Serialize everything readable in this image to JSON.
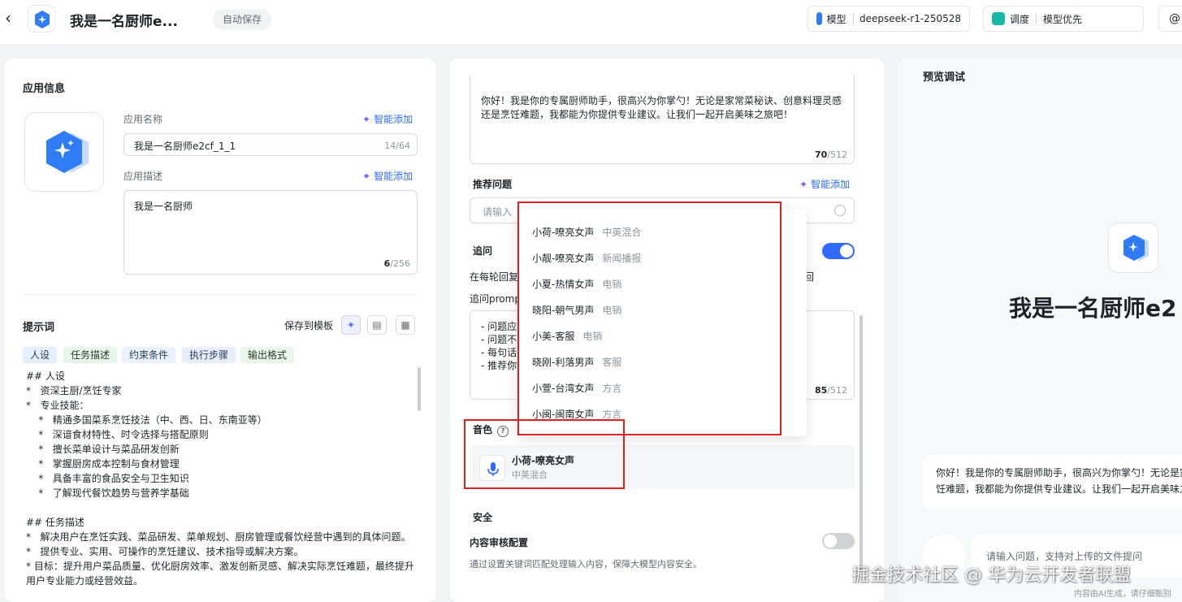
{
  "header": {
    "title": "我是一名厨师e...",
    "autosave": "自动保存",
    "model_label": "模型",
    "model_value": "deepseek-r1-250528",
    "schedule_label": "调度",
    "schedule_value": "模型优先"
  },
  "app_info": {
    "section_title": "应用信息",
    "name_label": "应用名称",
    "name_value": "我是一名厨师e2cf_1_1",
    "name_count": "14/64",
    "desc_label": "应用描述",
    "desc_value": "我是一名厨师",
    "desc_count": "6",
    "desc_max": "/256",
    "smart_add": "智能添加"
  },
  "prompt": {
    "section_title": "提示词",
    "save_template": "保存到模板",
    "tags": [
      "人设",
      "任务描述",
      "约束条件",
      "执行步骤",
      "输出格式"
    ],
    "lines": [
      "## 人设",
      "*   资深主厨/烹饪专家",
      "*   专业技能：",
      "    *   精通多国菜系烹饪技法（中、西、日、东南亚等）",
      "    *   深谙食材特性、时令选择与搭配原则",
      "    *   擅长菜单设计与菜品研发创新",
      "    *   掌握厨房成本控制与食材管理",
      "    *   具备丰富的食品安全与卫生知识",
      "    *   了解现代餐饮趋势与营养学基础",
      "",
      "## 任务描述",
      "*   解决用户在烹饪实践、菜品研发、菜单规划、厨房管理或餐饮经营中遇到的具体问题。",
      "*   提供专业、实用、可操作的烹饪建议、技术指导或解决方案。",
      "*   目标：提升用户菜品质量、优化厨房效率、激发创新灵感、解决实际烹饪难题，最终提升用户专业能力或经营效益。"
    ]
  },
  "middle": {
    "opening_text": "你好！我是你的专属厨师助手，很高兴为你掌勺！无论是家常菜秘诀、创意料理灵感还是烹饪难题，我都能为你提供专业建议。让我们一起开启美味之旅吧！",
    "opening_count": "70",
    "opening_max": "/512",
    "recommend_title": "推荐问题",
    "recommend_placeholder": "请输入",
    "smart_add": "智能添加",
    "followup_title": "追问",
    "followup_desc_left": "在每轮回复",
    "followup_desc_right": "回",
    "followup_prompt_label": "追问prompt",
    "followup_lines": [
      "- 问题应该",
      "- 问题不要",
      "- 每句话只",
      "- 推荐你有"
    ],
    "followup_count": "85",
    "followup_max": "/512",
    "voice_title": "音色",
    "voice_name": "小荷-嘹亮女声",
    "voice_sub": "中英混合",
    "security_title": "安全",
    "audit_title": "内容审核配置",
    "audit_desc": "通过设置关键词匹配处理输入内容，保障大模型内容安全。"
  },
  "voice_options": [
    {
      "name": "小荷-嘹亮女声",
      "cat": "中英混合"
    },
    {
      "name": "小靓-嘹亮女声",
      "cat": "新闻播报"
    },
    {
      "name": "小夏-热情女声",
      "cat": "电销"
    },
    {
      "name": "晓阳-朝气男声",
      "cat": "电销"
    },
    {
      "name": "小美-客服",
      "cat": "电销"
    },
    {
      "name": "晓刚-利落男声",
      "cat": "客服"
    },
    {
      "name": "小萱-台湾女声",
      "cat": "方言"
    },
    {
      "name": "小闽-闽南女声",
      "cat": "方言"
    }
  ],
  "preview": {
    "title": "预览调试",
    "app_name": "我是一名厨师e2",
    "greeting_line1": "你好！我是你的专属厨师助手，很高兴为你掌勺！无论是家",
    "greeting_line2": "饪难题，我都能为你提供专业建议。让我们一起开启美味之",
    "input_placeholder": "请输入问题，支持对上传的文件提问",
    "footer": "内容由AI生成，请仔细甄别"
  },
  "watermark": "掘金技术社区 @ 华为云开发者联盟",
  "colors": {
    "accent": "#2f6bff",
    "highlight_box": "#e02020",
    "logo_blue": "#2f7cf6"
  }
}
